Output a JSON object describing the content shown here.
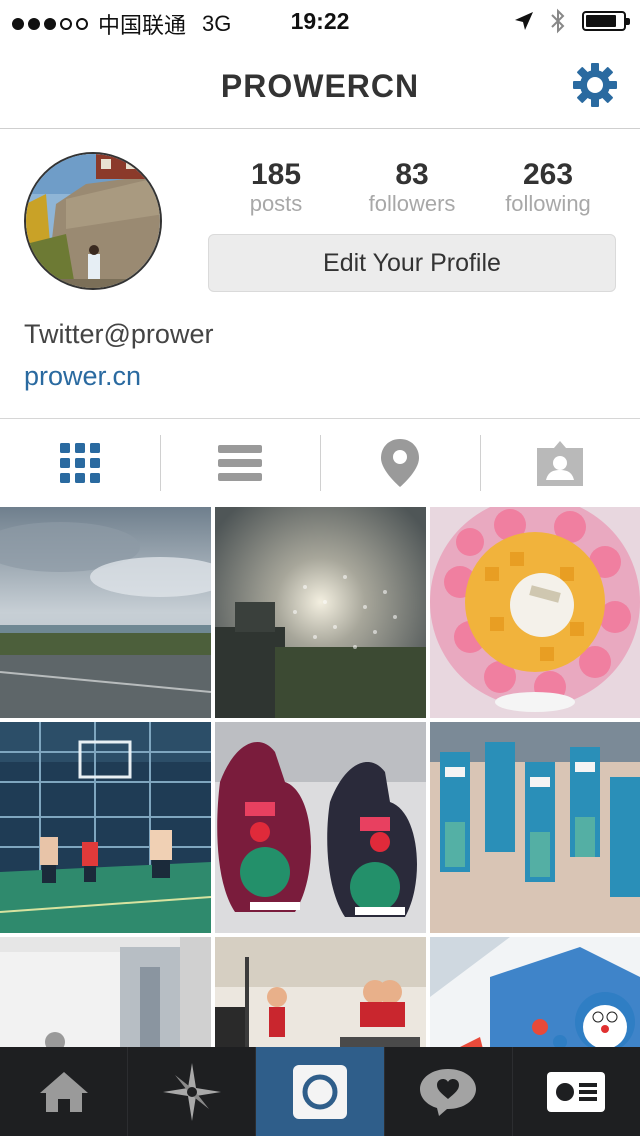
{
  "status_bar": {
    "carrier": "中国联通",
    "network": "3G",
    "time": "19:22",
    "signal_filled": 3,
    "signal_total": 5
  },
  "nav": {
    "title": "PROWERCN",
    "settings_icon": "gear-icon",
    "accent_color": "#2a6aa0"
  },
  "profile": {
    "stats": [
      {
        "value": "185",
        "label": "posts"
      },
      {
        "value": "83",
        "label": "followers"
      },
      {
        "value": "263",
        "label": "following"
      }
    ],
    "edit_button": "Edit Your Profile",
    "bio": "Twitter@prower",
    "website": "prower.cn"
  },
  "view_tabs": [
    {
      "name": "grid-view",
      "icon": "grid-icon",
      "active": true
    },
    {
      "name": "list-view",
      "icon": "list-icon",
      "active": false
    },
    {
      "name": "map-view",
      "icon": "location-pin-icon",
      "active": false
    },
    {
      "name": "tagged-view",
      "icon": "tagged-person-icon",
      "active": false
    }
  ],
  "photos": [
    {
      "subject": "cloudy-road"
    },
    {
      "subject": "rainy-window-sunset"
    },
    {
      "subject": "mango-cake"
    },
    {
      "subject": "basketball-court"
    },
    {
      "subject": "tiger-toys"
    },
    {
      "subject": "water-bottles"
    },
    {
      "subject": "laptop-desk"
    },
    {
      "subject": "figurines"
    },
    {
      "subject": "doraemon-box"
    }
  ],
  "tab_bar": [
    {
      "name": "home",
      "icon": "home-icon",
      "active": false
    },
    {
      "name": "explore",
      "icon": "star-compass-icon",
      "active": false
    },
    {
      "name": "camera",
      "icon": "camera-icon",
      "active": true
    },
    {
      "name": "activity",
      "icon": "heart-bubble-icon",
      "active": false
    },
    {
      "name": "profile",
      "icon": "profile-card-icon",
      "active": false
    }
  ]
}
